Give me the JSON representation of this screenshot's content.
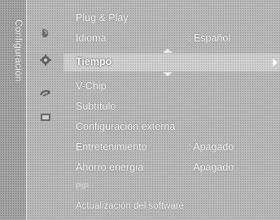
{
  "sidebar": {
    "title": "Configuración"
  },
  "icons": [
    {
      "name": "picture-icon"
    },
    {
      "name": "gear-icon"
    },
    {
      "name": "satellite-dish-icon"
    },
    {
      "name": "input-icon"
    }
  ],
  "menu": {
    "items": [
      {
        "label": "Plug & Play",
        "value": ""
      },
      {
        "label": "Idioma",
        "value": ": Español"
      },
      {
        "label": "Tiempo",
        "value": ""
      },
      {
        "label": "V-Chip",
        "value": ""
      },
      {
        "label": "Subtítulo",
        "value": ""
      },
      {
        "label": "Configuración externa",
        "value": ""
      },
      {
        "label": "Entretenimiento",
        "value": ": Apagado"
      },
      {
        "label": "Ahorro energía",
        "value": ": Apagado"
      },
      {
        "label": "PIP",
        "value": ""
      },
      {
        "label": "Actualización del software",
        "value": ""
      }
    ]
  }
}
